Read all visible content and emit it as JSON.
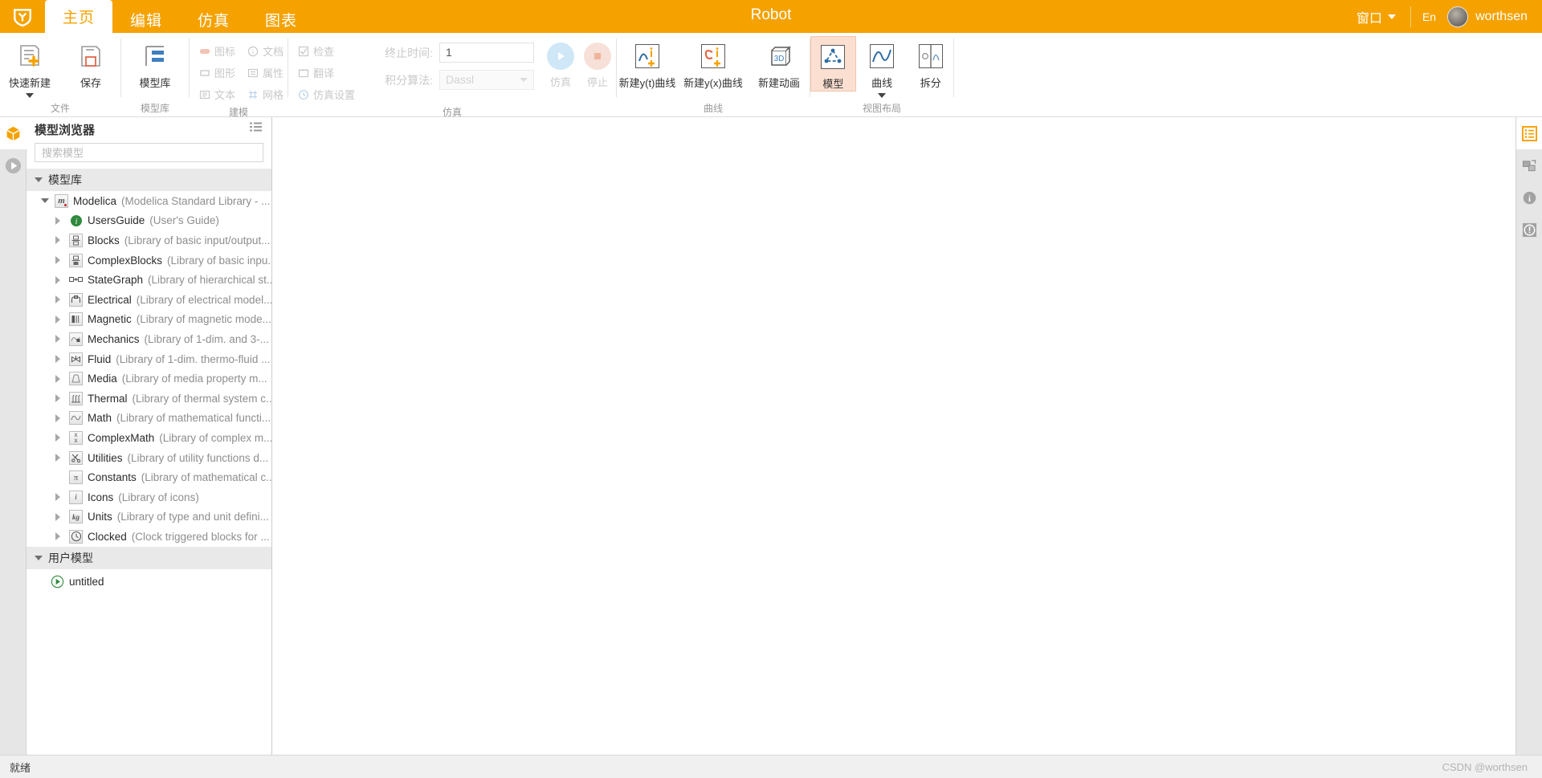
{
  "titlebar": {
    "logo_icon": "cube-logo-icon",
    "app_title": "Robot",
    "tabs": [
      {
        "label": "主页",
        "active": true
      },
      {
        "label": "编辑",
        "active": false
      },
      {
        "label": "仿真",
        "active": false
      },
      {
        "label": "图表",
        "active": false
      }
    ],
    "window_menu": "窗口",
    "language": "En",
    "username": "worthsen",
    "accent_color": "#f5a200"
  },
  "ribbon": {
    "groups": [
      {
        "label": "文件"
      },
      {
        "label": "模型库"
      },
      {
        "label": "建模"
      },
      {
        "label": "仿真"
      },
      {
        "label": "曲线"
      },
      {
        "label": "视图布局"
      }
    ],
    "file": {
      "new_label": "快速新建",
      "save_label": "保存"
    },
    "library": {
      "modellib_label": "模型库"
    },
    "modeling": {
      "items": [
        {
          "label": "图标",
          "icon": "icon-shape-icon"
        },
        {
          "label": "文档",
          "icon": "document-info-icon"
        },
        {
          "label": "图形",
          "icon": "diagram-icon"
        },
        {
          "label": "属性",
          "icon": "properties-icon"
        },
        {
          "label": "文本",
          "icon": "text-icon"
        },
        {
          "label": "网格",
          "icon": "grid-icon"
        }
      ]
    },
    "build": {
      "items": [
        {
          "label": "检查",
          "icon": "check-icon"
        },
        {
          "label": "翻译",
          "icon": "translate-icon"
        },
        {
          "label": "仿真设置",
          "icon": "sim-settings-icon"
        }
      ]
    },
    "simulation": {
      "stop_time_label": "终止时间:",
      "stop_time_value": "1",
      "solver_label": "积分算法:",
      "solver_value": "Dassl",
      "run_label": "仿真",
      "stop_label": "停止"
    },
    "curves": {
      "items": [
        {
          "label": "新建y(t)曲线",
          "icon": "new-yt-curve-icon"
        },
        {
          "label": "新建y(x)曲线",
          "icon": "new-yx-curve-icon"
        },
        {
          "label": "新建动画",
          "icon": "new-animation-3d-icon"
        }
      ]
    },
    "layout": {
      "items": [
        {
          "label": "模型",
          "icon": "model-view-icon",
          "selected": true
        },
        {
          "label": "曲线",
          "icon": "curve-view-icon",
          "selected": false
        },
        {
          "label": "拆分",
          "icon": "split-view-icon",
          "selected": false
        }
      ]
    }
  },
  "left_rail": {
    "items": [
      {
        "icon": "cube-model-icon",
        "active": true
      },
      {
        "icon": "play-simulate-icon",
        "active": false
      }
    ]
  },
  "browser": {
    "title": "模型浏览器",
    "list_icon": "list-view-icon",
    "search_placeholder": "搜索模型",
    "search_value": "",
    "sections": [
      {
        "label": "模型库",
        "expanded": true,
        "root": {
          "name": "Modelica",
          "desc": "(Modelica Standard Library - ...",
          "icon": "modelica-m-icon",
          "expanded": true,
          "children": [
            {
              "name": "UsersGuide",
              "desc": "(User's Guide)",
              "icon": "info-green-icon"
            },
            {
              "name": "Blocks",
              "desc": "(Library of basic input/output...",
              "icon": "blocks-icon"
            },
            {
              "name": "ComplexBlocks",
              "desc": "(Library of basic inpu...",
              "icon": "complexblocks-icon"
            },
            {
              "name": "StateGraph",
              "desc": "(Library of hierarchical st...",
              "icon": "stategraph-icon"
            },
            {
              "name": "Electrical",
              "desc": "(Library of electrical model...",
              "icon": "electrical-icon"
            },
            {
              "name": "Magnetic",
              "desc": "(Library of magnetic mode...",
              "icon": "magnetic-icon"
            },
            {
              "name": "Mechanics",
              "desc": "(Library of 1-dim. and 3-...",
              "icon": "mechanics-icon"
            },
            {
              "name": "Fluid",
              "desc": "(Library of 1-dim. thermo-fluid ...",
              "icon": "fluid-valve-icon"
            },
            {
              "name": "Media",
              "desc": "(Library of media property m...",
              "icon": "media-icon"
            },
            {
              "name": "Thermal",
              "desc": "(Library of thermal system c...",
              "icon": "thermal-icon"
            },
            {
              "name": "Math",
              "desc": "(Library of mathematical functi...",
              "icon": "math-sine-icon"
            },
            {
              "name": "ComplexMath",
              "desc": "(Library of complex m...",
              "icon": "complexmath-icon"
            },
            {
              "name": "Utilities",
              "desc": "(Library of utility functions d...",
              "icon": "utilities-scissors-icon"
            },
            {
              "name": "Constants",
              "desc": "(Library of mathematical c...",
              "icon": "constants-pi-icon",
              "leaf": true
            },
            {
              "name": "Icons",
              "desc": "(Library of icons)",
              "icon": "icons-i-icon"
            },
            {
              "name": "Units",
              "desc": "(Library of type and unit defini...",
              "icon": "units-kg-icon"
            },
            {
              "name": "Clocked",
              "desc": "(Clock triggered blocks for ...",
              "icon": "clocked-clock-icon"
            }
          ]
        }
      },
      {
        "label": "用户模型",
        "expanded": true,
        "items": [
          {
            "name": "untitled",
            "icon": "model-play-icon"
          }
        ]
      }
    ]
  },
  "right_rail": {
    "items": [
      {
        "icon": "component-list-icon",
        "active": true
      },
      {
        "icon": "component-tree-icon",
        "active": false
      },
      {
        "icon": "info-circle-icon",
        "active": false
      },
      {
        "icon": "warning-circle-icon",
        "active": false
      }
    ]
  },
  "statusbar": {
    "status_text": "就绪",
    "watermark": "CSDN @worthsen"
  }
}
